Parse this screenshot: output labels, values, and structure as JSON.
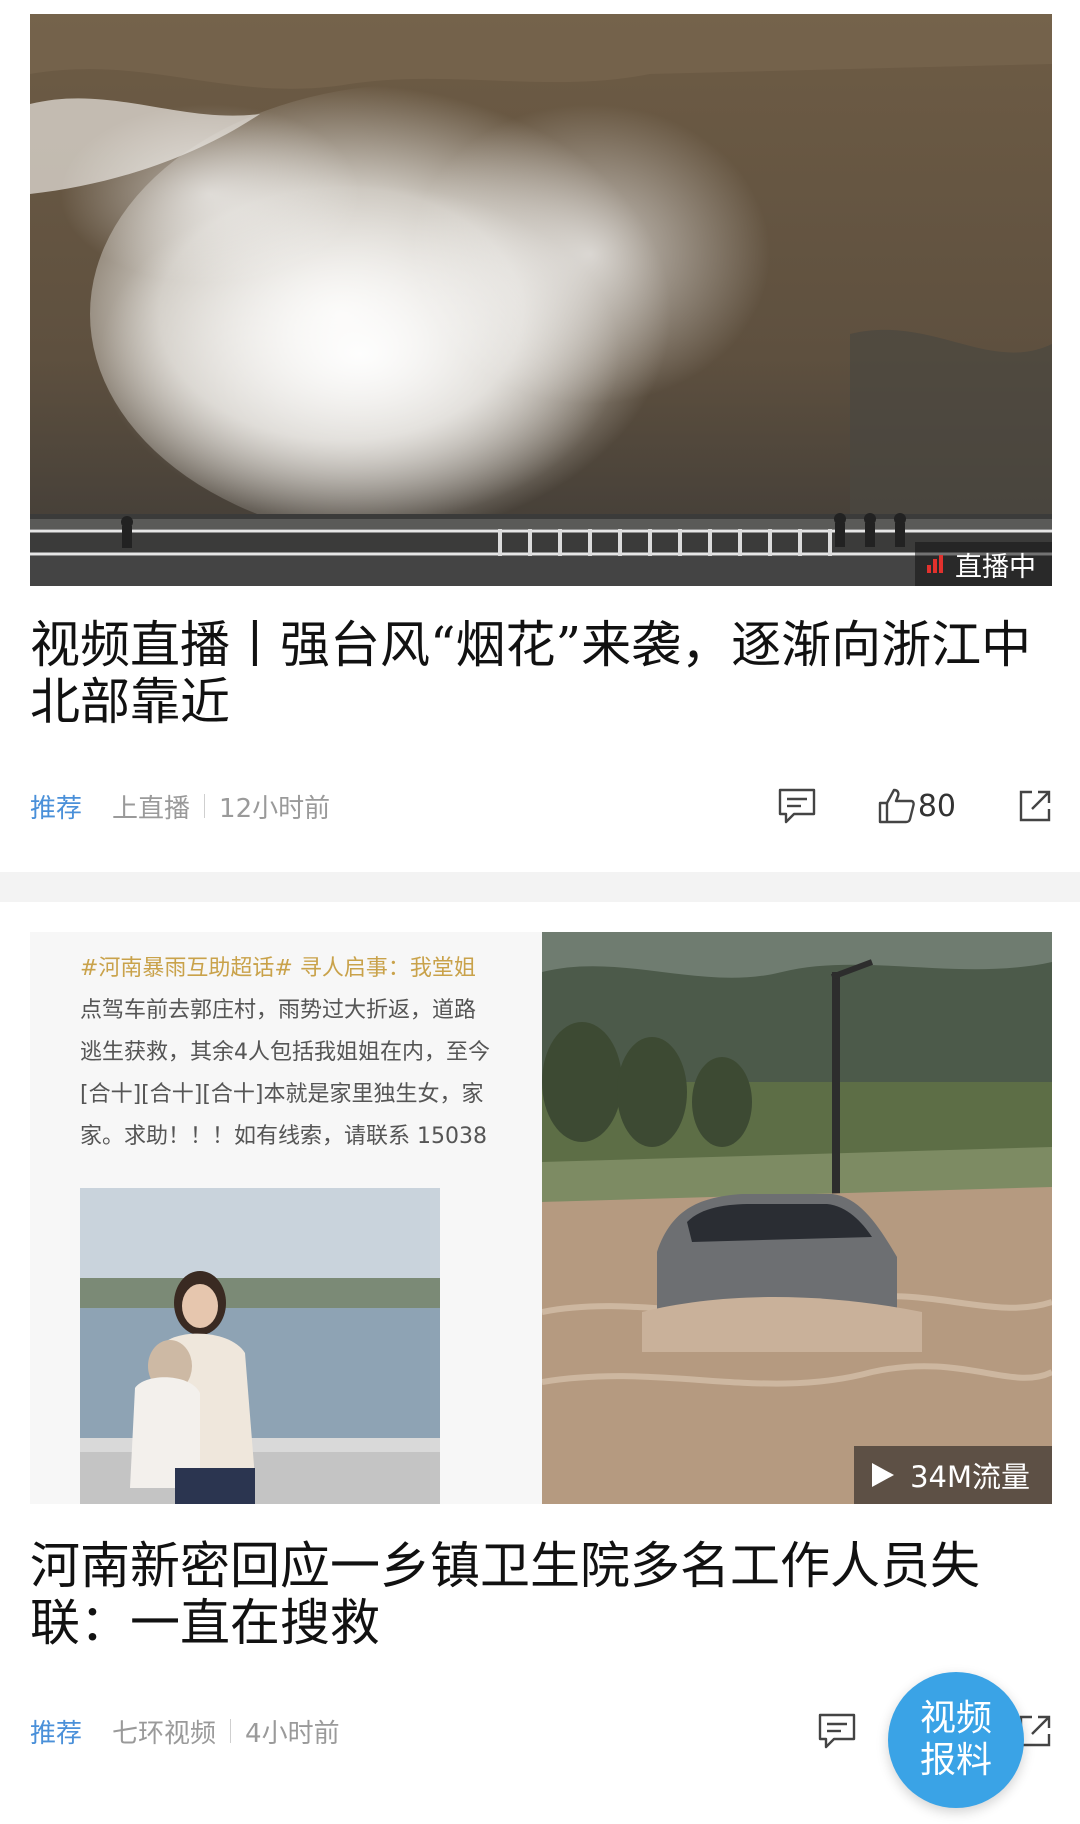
{
  "feed": [
    {
      "title": "视频直播丨强台风“烟花”来袭，逐渐向浙江中北部靠近",
      "badge": "直播中",
      "tag": "推荐",
      "source": "上直播",
      "time": "12小时前",
      "likes": "80",
      "icons": [
        "comment-icon",
        "like-icon",
        "share-icon"
      ]
    },
    {
      "title": "河南新密回应一乡镇卫生院多名工作人员失联：一直在搜救",
      "badge": "34M流量",
      "tag": "推荐",
      "source": "七环视频",
      "time": "4小时前",
      "post_lines": [
        "#河南暴雨互助超话# 寻人启事：我堂姐",
        "点驾车前去郭庄村，雨势过大折返，道路",
        "逃生获救，其余4人包括我姐姐在内，至今",
        "[合十][合十][合十]本就是家里独生女，家",
        "家。求助！！！如有线索，请联系 15038"
      ],
      "icons": [
        "comment-icon",
        "like-icon",
        "share-icon",
        "play-icon"
      ]
    }
  ],
  "fab": {
    "line1": "视频",
    "line2": "报料"
  },
  "colors": {
    "tag": "#4a90d9",
    "meta": "#9a9a9a",
    "fab": "#3aa3e6",
    "live": "#e2312d"
  }
}
